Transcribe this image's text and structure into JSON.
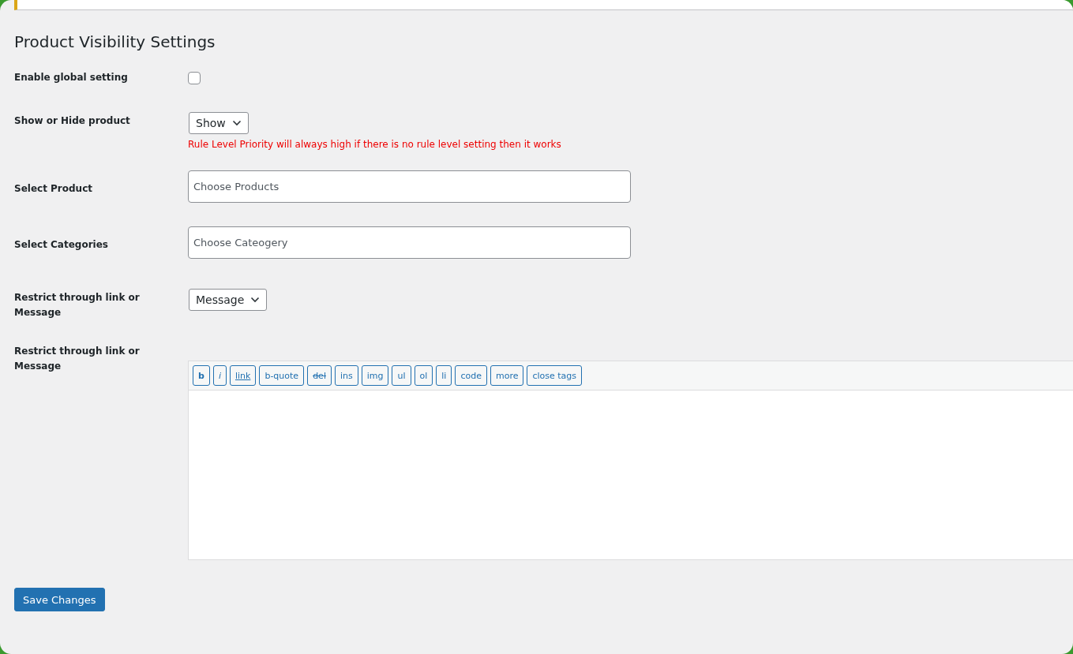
{
  "title": "Product Visibility Settings",
  "rows": [
    {
      "kind": "checkbox",
      "label": "Enable global setting",
      "checked": false
    },
    {
      "kind": "select",
      "label": "Show or Hide product",
      "value": "Show",
      "note": "Rule Level Priority will always high if there is no rule level setting then it works"
    },
    {
      "kind": "text",
      "label": "Select Product",
      "placeholder": "Choose Products"
    },
    {
      "kind": "text",
      "label": "Select Categories",
      "placeholder": "Choose Cateogery"
    },
    {
      "kind": "select",
      "label": "Restrict through link or Message",
      "value": "Message"
    },
    {
      "kind": "editor",
      "label": "Restrict through link or Message",
      "buttons": [
        {
          "label": "b",
          "kind": "bold"
        },
        {
          "label": "i",
          "kind": "italic"
        },
        {
          "label": "link",
          "kind": "underline"
        },
        {
          "label": "b-quote",
          "kind": "plain"
        },
        {
          "label": "del",
          "kind": "strike"
        },
        {
          "label": "ins",
          "kind": "plain"
        },
        {
          "label": "img",
          "kind": "plain"
        },
        {
          "label": "ul",
          "kind": "plain"
        },
        {
          "label": "ol",
          "kind": "plain"
        },
        {
          "label": "li",
          "kind": "plain"
        },
        {
          "label": "code",
          "kind": "plain"
        },
        {
          "label": "more",
          "kind": "plain"
        },
        {
          "label": "close tags",
          "kind": "plain"
        }
      ]
    }
  ],
  "save_button": "Save Changes"
}
